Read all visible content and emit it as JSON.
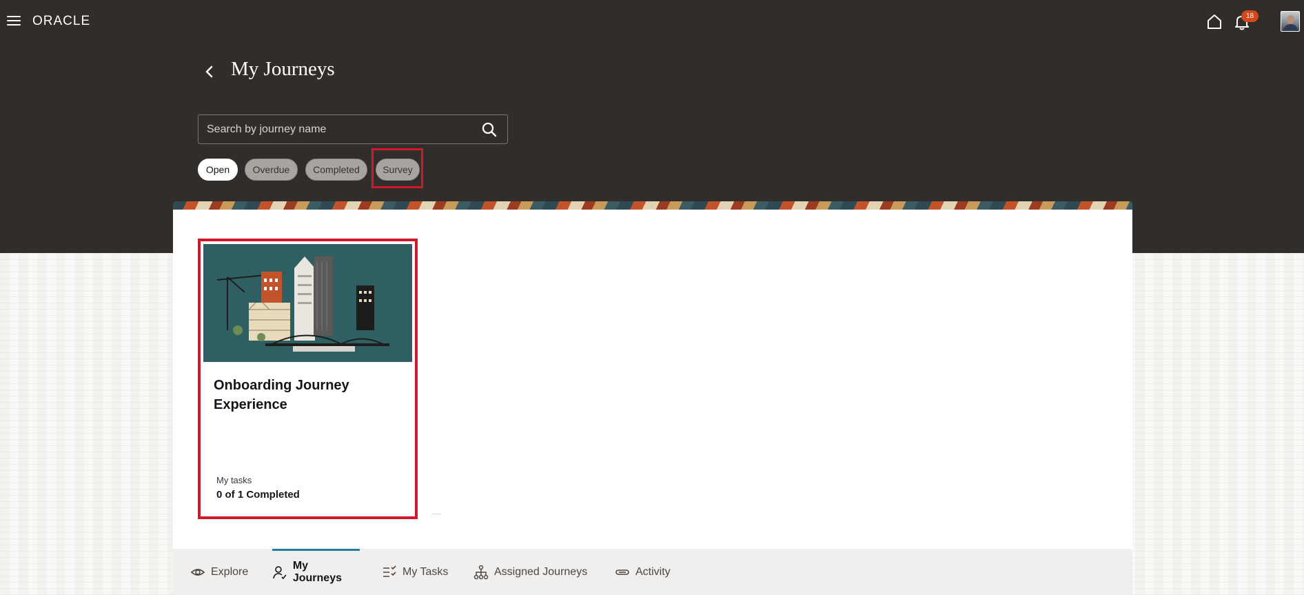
{
  "header": {
    "logo": "ORACLE",
    "notification_count": "18"
  },
  "page": {
    "title": "My Journeys"
  },
  "search": {
    "placeholder": "Search by journey name"
  },
  "filters": [
    {
      "label": "Open",
      "state": "selected"
    },
    {
      "label": "Overdue",
      "state": "unselected"
    },
    {
      "label": "Completed",
      "state": "unselected"
    },
    {
      "label": "Survey",
      "state": "unselected"
    }
  ],
  "journey_card": {
    "title": "Onboarding Journey Experience",
    "tasks_label": "My tasks",
    "tasks_value": "0 of 1 Completed"
  },
  "bottom_nav": [
    {
      "label": "Explore",
      "icon": "eye-icon"
    },
    {
      "label": "My Journeys",
      "icon": "person-icon",
      "active": true
    },
    {
      "label": "My Tasks",
      "icon": "checklist-icon"
    },
    {
      "label": "Assigned Journeys",
      "icon": "hierarchy-icon"
    },
    {
      "label": "Activity",
      "icon": "activity-icon"
    }
  ],
  "colors": {
    "header_bg": "#312d2a",
    "highlight": "#d3172a",
    "badge": "#d5481c",
    "active_tab": "#227e9e"
  }
}
